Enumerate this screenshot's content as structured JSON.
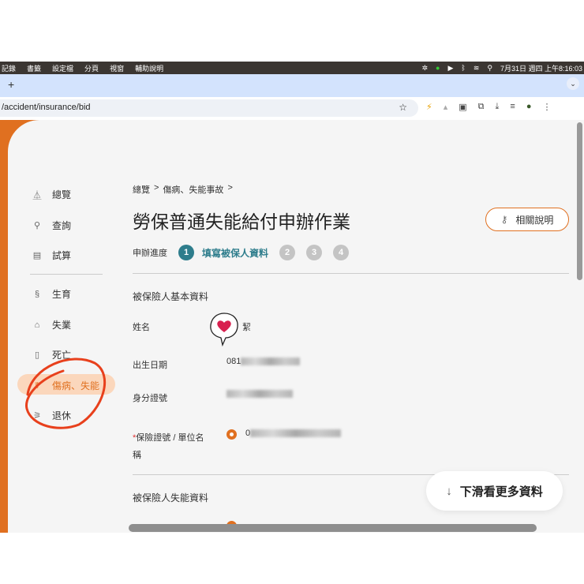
{
  "menubar": {
    "items": [
      "記錄",
      "書籤",
      "設定檔",
      "分頁",
      "視窗",
      "輔助說明"
    ],
    "clock": "7月31日 週四 上午8:16:03"
  },
  "browser": {
    "new_tab": "+",
    "url": "/accident/insurance/bid"
  },
  "sidebar": {
    "items": [
      {
        "label": "總覽",
        "icon": "overview-icon",
        "glyph": "⏅"
      },
      {
        "label": "查詢",
        "icon": "search-icon",
        "glyph": "⚲"
      },
      {
        "label": "試算",
        "icon": "calculator-icon",
        "glyph": "▤"
      },
      {
        "label": "生育",
        "icon": "birth-icon",
        "glyph": "§"
      },
      {
        "label": "失業",
        "icon": "unemployment-icon",
        "glyph": "⌂"
      },
      {
        "label": "死亡",
        "icon": "death-icon",
        "glyph": "▯"
      },
      {
        "label": "傷病、失能",
        "icon": "injury-icon",
        "glyph": "☤"
      },
      {
        "label": "退休",
        "icon": "retire-icon",
        "glyph": "⚞"
      }
    ]
  },
  "main": {
    "breadcrumb": [
      "總覽",
      ">",
      "傷病、失能事故",
      ">"
    ],
    "title": "勞保普通失能給付申辦作業",
    "help_button": "相關說明",
    "progress_label": "申辦進度",
    "steps": [
      "1",
      "2",
      "3",
      "4"
    ],
    "current_step_label": "填寫被保人資料",
    "section1": "被保險人基本資料",
    "fields": {
      "name_label": "姓名",
      "name_value": "絜",
      "dob_label": "出生日期",
      "dob_value": "081",
      "id_label": "身分證號",
      "insurance_label": "保險證號 / 單位名稱",
      "insurance_required": "*",
      "insurance_value": "0"
    },
    "section2": "被保險人失能資料",
    "scroll_hint": "下滑看更多資料"
  },
  "colors": {
    "accent": "#e07020",
    "step_active": "#2e7d8c",
    "annotation": "#e8401c"
  }
}
